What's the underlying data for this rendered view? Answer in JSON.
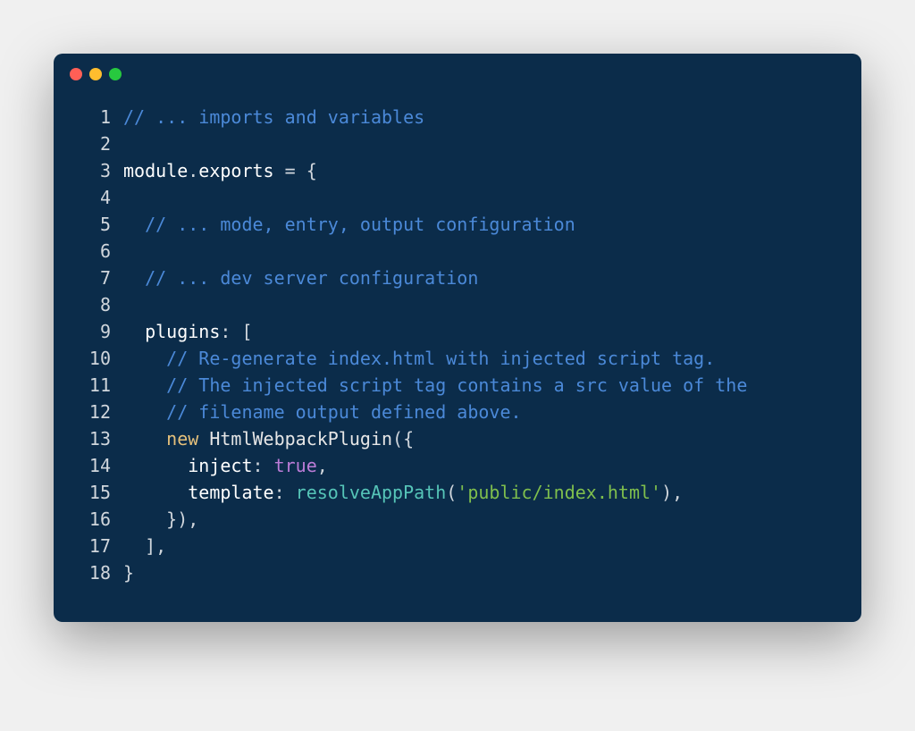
{
  "window": {
    "dots": [
      "red",
      "yellow",
      "green"
    ]
  },
  "code": {
    "lines": [
      {
        "num": "1",
        "tokens": [
          {
            "cls": "tok-comment",
            "text": "// ... imports and variables"
          }
        ]
      },
      {
        "num": "2",
        "tokens": []
      },
      {
        "num": "3",
        "tokens": [
          {
            "cls": "tok-module",
            "text": "module"
          },
          {
            "cls": "tok-punct",
            "text": "."
          },
          {
            "cls": "tok-module",
            "text": "exports"
          },
          {
            "cls": "tok-punct",
            "text": " = {"
          }
        ]
      },
      {
        "num": "4",
        "tokens": []
      },
      {
        "num": "5",
        "tokens": [
          {
            "cls": "",
            "text": "  "
          },
          {
            "cls": "tok-comment",
            "text": "// ... mode, entry, output configuration"
          }
        ]
      },
      {
        "num": "6",
        "tokens": []
      },
      {
        "num": "7",
        "tokens": [
          {
            "cls": "",
            "text": "  "
          },
          {
            "cls": "tok-comment",
            "text": "// ... dev server configuration"
          }
        ]
      },
      {
        "num": "8",
        "tokens": []
      },
      {
        "num": "9",
        "tokens": [
          {
            "cls": "",
            "text": "  "
          },
          {
            "cls": "tok-property",
            "text": "plugins"
          },
          {
            "cls": "tok-punct",
            "text": ": ["
          }
        ]
      },
      {
        "num": "10",
        "tokens": [
          {
            "cls": "",
            "text": "    "
          },
          {
            "cls": "tok-comment",
            "text": "// Re-generate index.html with injected script tag."
          }
        ]
      },
      {
        "num": "11",
        "tokens": [
          {
            "cls": "",
            "text": "    "
          },
          {
            "cls": "tok-comment",
            "text": "// The injected script tag contains a src value of the"
          }
        ]
      },
      {
        "num": "12",
        "tokens": [
          {
            "cls": "",
            "text": "    "
          },
          {
            "cls": "tok-comment",
            "text": "// filename output defined above."
          }
        ]
      },
      {
        "num": "13",
        "tokens": [
          {
            "cls": "",
            "text": "    "
          },
          {
            "cls": "tok-new",
            "text": "new"
          },
          {
            "cls": "",
            "text": " "
          },
          {
            "cls": "tok-class",
            "text": "HtmlWebpackPlugin"
          },
          {
            "cls": "tok-punct",
            "text": "({"
          }
        ]
      },
      {
        "num": "14",
        "tokens": [
          {
            "cls": "",
            "text": "      "
          },
          {
            "cls": "tok-property",
            "text": "inject"
          },
          {
            "cls": "tok-punct",
            "text": ": "
          },
          {
            "cls": "tok-boolean",
            "text": "true"
          },
          {
            "cls": "tok-punct",
            "text": ","
          }
        ]
      },
      {
        "num": "15",
        "tokens": [
          {
            "cls": "",
            "text": "      "
          },
          {
            "cls": "tok-property",
            "text": "template"
          },
          {
            "cls": "tok-punct",
            "text": ": "
          },
          {
            "cls": "tok-func",
            "text": "resolveAppPath"
          },
          {
            "cls": "tok-punct",
            "text": "("
          },
          {
            "cls": "tok-string",
            "text": "'public/index.html'"
          },
          {
            "cls": "tok-punct",
            "text": "),"
          }
        ]
      },
      {
        "num": "16",
        "tokens": [
          {
            "cls": "",
            "text": "    "
          },
          {
            "cls": "tok-punct",
            "text": "}),"
          }
        ]
      },
      {
        "num": "17",
        "tokens": [
          {
            "cls": "",
            "text": "  "
          },
          {
            "cls": "tok-punct",
            "text": "],"
          }
        ]
      },
      {
        "num": "18",
        "tokens": [
          {
            "cls": "tok-punct",
            "text": "}"
          }
        ]
      }
    ]
  }
}
